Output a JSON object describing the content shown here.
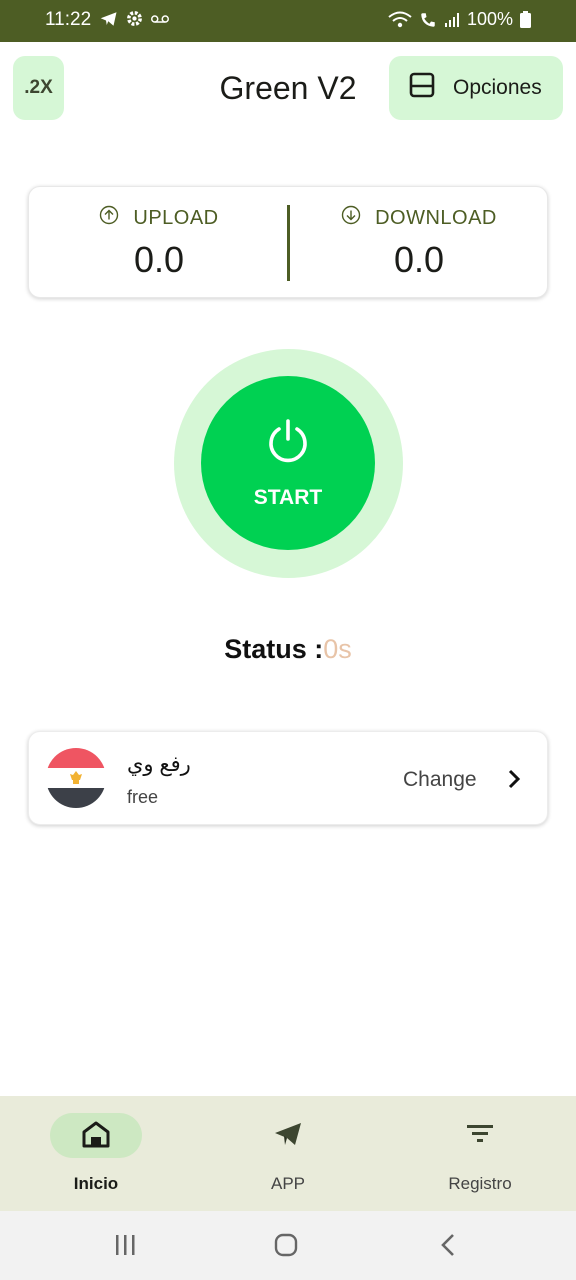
{
  "status_bar": {
    "time": "11:22",
    "battery": "100%",
    "background_color": "#4d5d24",
    "left_icons": [
      "telegram-icon",
      "settings-icon",
      "voicemail-icon"
    ],
    "right_icons": [
      "wifi-icon",
      "wifi-call-icon",
      "signal-icon",
      "battery-icon"
    ]
  },
  "header": {
    "speed_button_label": ".2X",
    "title": "Green V2",
    "options_label": "Opciones",
    "options_icon": "layout-panel-icon"
  },
  "traffic": {
    "upload_label": "UPLOAD",
    "upload_value": "0.0",
    "download_label": "DOWNLOAD",
    "download_value": "0.0",
    "accent_color": "#4d5d24"
  },
  "connect": {
    "label": "START",
    "icon": "power-icon",
    "button_color": "#00d152",
    "ring_color": "#d6f7d6"
  },
  "status": {
    "prefix": "Status :",
    "duration": "0s"
  },
  "server": {
    "flag": "egypt-flag",
    "name": "رفع وي",
    "type": "free",
    "change_label": "Change"
  },
  "bottom_nav": {
    "items": [
      {
        "label": "Inicio",
        "icon": "home-icon",
        "active": true
      },
      {
        "label": "APP",
        "icon": "send-icon",
        "active": false
      },
      {
        "label": "Registro",
        "icon": "filter-icon",
        "active": false
      }
    ]
  },
  "system_nav": [
    "recent-apps-icon",
    "home-circle-icon",
    "back-icon"
  ]
}
